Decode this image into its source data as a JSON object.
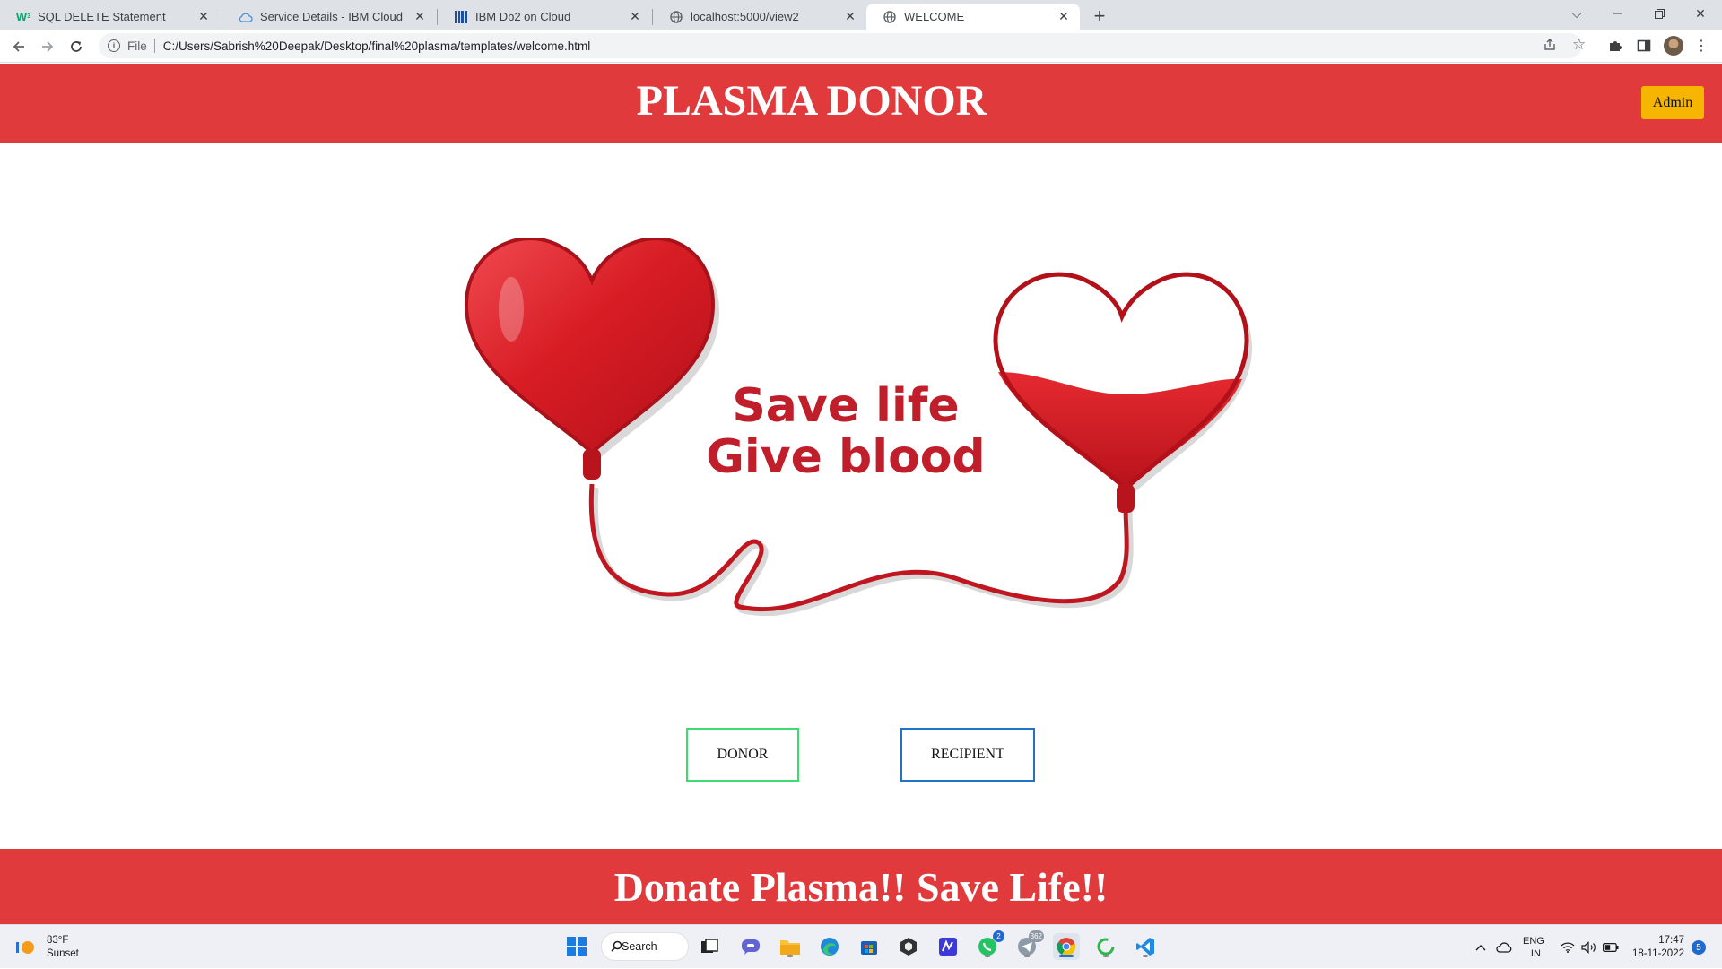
{
  "browser": {
    "tabs": [
      {
        "title": "SQL DELETE Statement",
        "favicon": "w3schools-icon"
      },
      {
        "title": "Service Details - IBM Cloud",
        "favicon": "cloud-icon"
      },
      {
        "title": "IBM Db2 on Cloud",
        "favicon": "db2-icon"
      },
      {
        "title": "localhost:5000/view2",
        "favicon": "globe-icon"
      },
      {
        "title": "WELCOME",
        "favicon": "globe-icon"
      }
    ],
    "address": {
      "scheme": "File",
      "url": "C:/Users/Sabrish%20Deepak/Desktop/final%20plasma/templates/welcome.html"
    }
  },
  "page": {
    "header": {
      "title": "PLASMA DONOR",
      "admin_label": "Admin"
    },
    "hero": {
      "line1": "Save life",
      "line2": "Give blood"
    },
    "buttons": {
      "donor": "DONOR",
      "recipient": "RECIPIENT"
    },
    "footer": {
      "text": "Donate Plasma!! Save Life!!"
    },
    "colors": {
      "brand_red": "#e03a3c",
      "admin_yellow": "#f6b500",
      "donor_border": "#3ddc6e",
      "recipient_border": "#1f74c7"
    }
  },
  "taskbar": {
    "weather": {
      "temp": "83°F",
      "condition": "Sunset"
    },
    "search_label": "Search",
    "badges": {
      "whatsapp": "2",
      "telegram": "362"
    },
    "language": {
      "line1": "ENG",
      "line2": "IN"
    },
    "clock": {
      "time": "17:47",
      "date": "18-11-2022"
    },
    "notifications": "5"
  }
}
